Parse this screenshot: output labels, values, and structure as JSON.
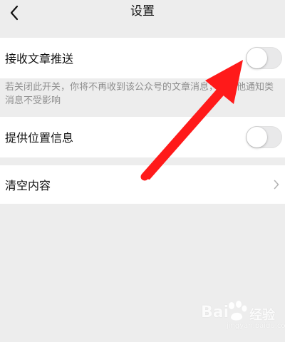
{
  "header": {
    "title": "设置",
    "back_icon": "chevron-left-icon"
  },
  "settings": {
    "article_push": {
      "label": "接收文章推送",
      "toggle_on": false
    },
    "hint": "若关闭此开关，你将不再收到该公众号的文章消息，但其他通知类消息不受影响",
    "location": {
      "label": "提供位置信息",
      "toggle_on": false
    },
    "clear": {
      "label": "清空内容",
      "chevron_icon": "chevron-right-icon"
    }
  },
  "annotation": {
    "arrow_color": "#ff1a1a",
    "target": "article-push-toggle"
  },
  "watermark": {
    "brand": "Bai",
    "brand2": "经验",
    "sub": "jingyan.baidu.com"
  },
  "colors": {
    "background": "#ededed",
    "cell": "#ffffff",
    "hint_text": "#8e8e8e",
    "toggle_off": "#e9e9ea"
  }
}
